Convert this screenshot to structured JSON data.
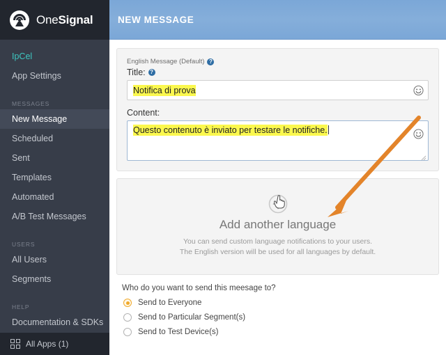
{
  "brand": {
    "name_part1": "One",
    "name_part2": "Signal",
    "logo_icon": "onesignal-bell-logo"
  },
  "sidebar": {
    "app_name": "IpCel",
    "items": [
      {
        "label": "App Settings",
        "active": false
      },
      {
        "label": "New Message",
        "active": true
      },
      {
        "label": "Scheduled",
        "active": false
      },
      {
        "label": "Sent",
        "active": false
      },
      {
        "label": "Templates",
        "active": false
      },
      {
        "label": "Automated",
        "active": false
      },
      {
        "label": "A/B Test Messages",
        "active": false
      },
      {
        "label": "All Users",
        "active": false
      },
      {
        "label": "Segments",
        "active": false
      },
      {
        "label": "Documentation & SDKs",
        "active": false
      }
    ],
    "groups": {
      "messages": "MESSAGES",
      "users": "USERS",
      "help": "HELP"
    },
    "footer": {
      "label": "All Apps (1)",
      "icon": "grid-icon"
    },
    "colors": {
      "background": "#373d49",
      "brand_background": "#22262e",
      "active_item": "#434a58",
      "app_name": "#3ec6c0"
    }
  },
  "topbar": {
    "title": "NEW MESSAGE",
    "background": "#85aeda"
  },
  "message_card": {
    "language_label": "English Message (Default)",
    "language_help_icon": "question-mark-icon",
    "title_label": "Title:",
    "title_help_icon": "question-mark-icon",
    "title_value": "Notifica di prova",
    "title_placeholder": "",
    "content_label": "Content:",
    "content_value": "Questo contenuto è inviato per testare le notifiche.",
    "content_placeholder": "",
    "emoji_icon": "smiley-face-icon",
    "highlight_color": "#fbf84e"
  },
  "add_language": {
    "plus_icon": "plus-circle-icon",
    "title": "Add another language",
    "subtitle_line1": "You can send custom language notifications to your users.",
    "subtitle_line2": "The English version will be used for all languages by default.",
    "cursor_icon": "pointing-hand-cursor"
  },
  "audience": {
    "question": "Who do you want to send this meesage to?",
    "options": [
      {
        "label": "Send to Everyone",
        "selected": true
      },
      {
        "label": "Send to Particular Segment(s)",
        "selected": false
      },
      {
        "label": "Send to Test Device(s)",
        "selected": false
      }
    ],
    "selected_color": "#f0a92b"
  },
  "annotation": {
    "arrow_icon": "orange-arrow-annotation",
    "color": "#e3842a"
  }
}
